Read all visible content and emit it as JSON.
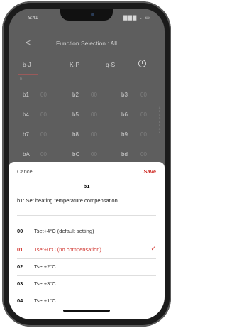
{
  "status": {
    "time": "9:41",
    "signal": "▇▇▇ ◒ ▭"
  },
  "nav": {
    "back": "<",
    "title": "Function Selection : All"
  },
  "tabs": [
    {
      "label": "b-J"
    },
    {
      "label": "K-P"
    },
    {
      "label": "q-S"
    }
  ],
  "section_label": "b",
  "grid": [
    [
      {
        "code": "b1",
        "val": "00"
      },
      {
        "code": "b2",
        "val": "00"
      },
      {
        "code": "b3",
        "val": "00"
      }
    ],
    [
      {
        "code": "b4",
        "val": "00"
      },
      {
        "code": "b5",
        "val": "00"
      },
      {
        "code": "b6",
        "val": "00"
      }
    ],
    [
      {
        "code": "b7",
        "val": "00"
      },
      {
        "code": "b8",
        "val": "00"
      },
      {
        "code": "b9",
        "val": "00"
      }
    ],
    [
      {
        "code": "bA",
        "val": "00"
      },
      {
        "code": "bC",
        "val": "00"
      },
      {
        "code": "bd",
        "val": "00"
      }
    ]
  ],
  "scroll_index": "A B C D E F G H",
  "sheet": {
    "cancel": "Cancel",
    "save": "Save",
    "code": "b1",
    "description": "b1: Set heating temperature compensation",
    "options": [
      {
        "num": "00",
        "text": "Tset+4°C (default setting)",
        "selected": false
      },
      {
        "num": "01",
        "text": "Tset+0°C (no compensation)",
        "selected": true
      },
      {
        "num": "02",
        "text": "Tset+2°C",
        "selected": false
      },
      {
        "num": "03",
        "text": "Tset+3°C",
        "selected": false
      },
      {
        "num": "04",
        "text": "Tset+1°C",
        "selected": false
      }
    ],
    "check": "✓"
  },
  "colors": {
    "accent": "#d0302a",
    "overlay": "#5e5e5e"
  }
}
